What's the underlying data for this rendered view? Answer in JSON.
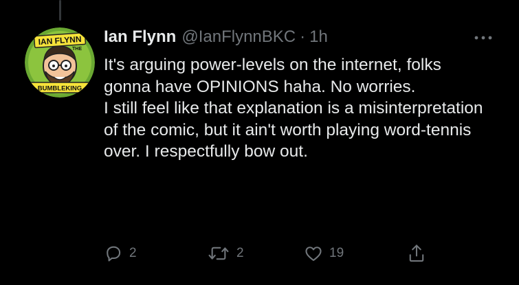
{
  "tweet": {
    "display_name": "Ian Flynn",
    "handle": "@IanFlynnBKC",
    "separator": "·",
    "time": "1h",
    "avatar": {
      "top_text": "IAN FLYNN",
      "small_text": "THE",
      "bottom_text": "BUMBLEKING",
      "bg_color": "#6aa832",
      "ring_color": "#7bbd3a"
    },
    "text_lines": [
      "It's arguing power-levels on the internet, folks gonna have OPINIONS haha. No worries.",
      "I still feel like that explanation is a misinterpretation of the comic, but it ain't worth playing word-tennis over. I respectfully bow out."
    ],
    "actions": {
      "reply": {
        "icon": "reply-icon",
        "count": "2"
      },
      "retweet": {
        "icon": "retweet-icon",
        "count": "2"
      },
      "like": {
        "icon": "heart-icon",
        "count": "19"
      },
      "share": {
        "icon": "share-icon"
      }
    },
    "more_icon": "more-icon"
  },
  "colors": {
    "background": "#000000",
    "primary_text": "#e7e9ea",
    "secondary_text": "#71767b",
    "thread_line": "#333639"
  }
}
